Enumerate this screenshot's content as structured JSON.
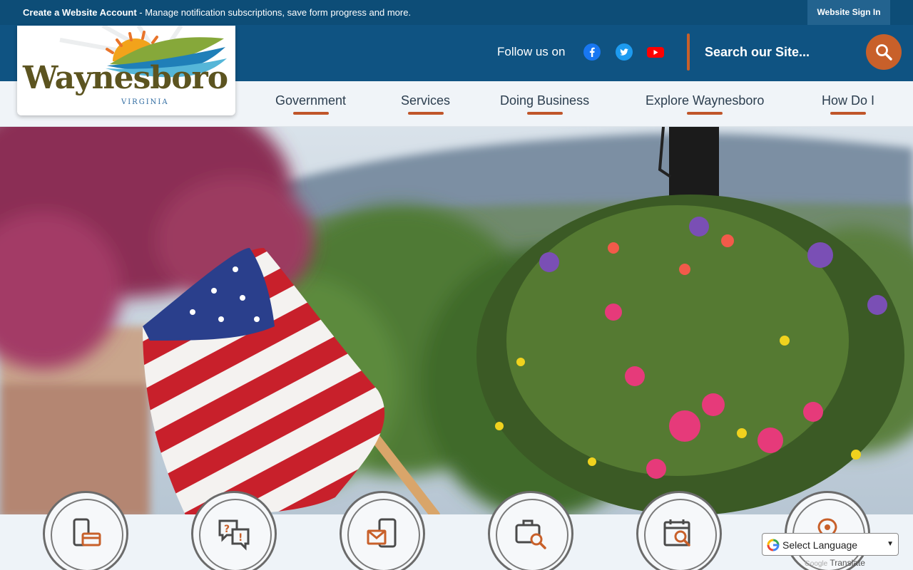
{
  "topbar": {
    "create_account_label": "Create a Website Account",
    "create_account_desc": " - Manage notification subscriptions, save form progress and more.",
    "signin_label": "Website Sign In"
  },
  "logo": {
    "wordmark": "Waynesboro",
    "subtitle": "VIRGINIA"
  },
  "header": {
    "follow_label": "Follow us on",
    "social": [
      "facebook-icon",
      "twitter-icon",
      "youtube-icon"
    ],
    "search_placeholder": "Search our Site..."
  },
  "nav": {
    "items": [
      {
        "label": "Government"
      },
      {
        "label": "Services"
      },
      {
        "label": "Doing Business"
      },
      {
        "label": "Explore Waynesboro"
      },
      {
        "label": "How Do I"
      }
    ]
  },
  "quick_links": [
    {
      "icon": "mobile-payment-icon"
    },
    {
      "icon": "questions-chat-icon"
    },
    {
      "icon": "mobile-mail-icon"
    },
    {
      "icon": "briefcase-search-icon"
    },
    {
      "icon": "calendar-search-icon"
    },
    {
      "icon": "location-person-icon"
    }
  ],
  "translate": {
    "select_label": "Select Language",
    "powered_google": "Google",
    "powered_translate": "Translate"
  },
  "colors": {
    "topbar": "#0d4d77",
    "header": "#0f5382",
    "accent": "#c8602a",
    "nav_bg": "#f0f4f8"
  }
}
